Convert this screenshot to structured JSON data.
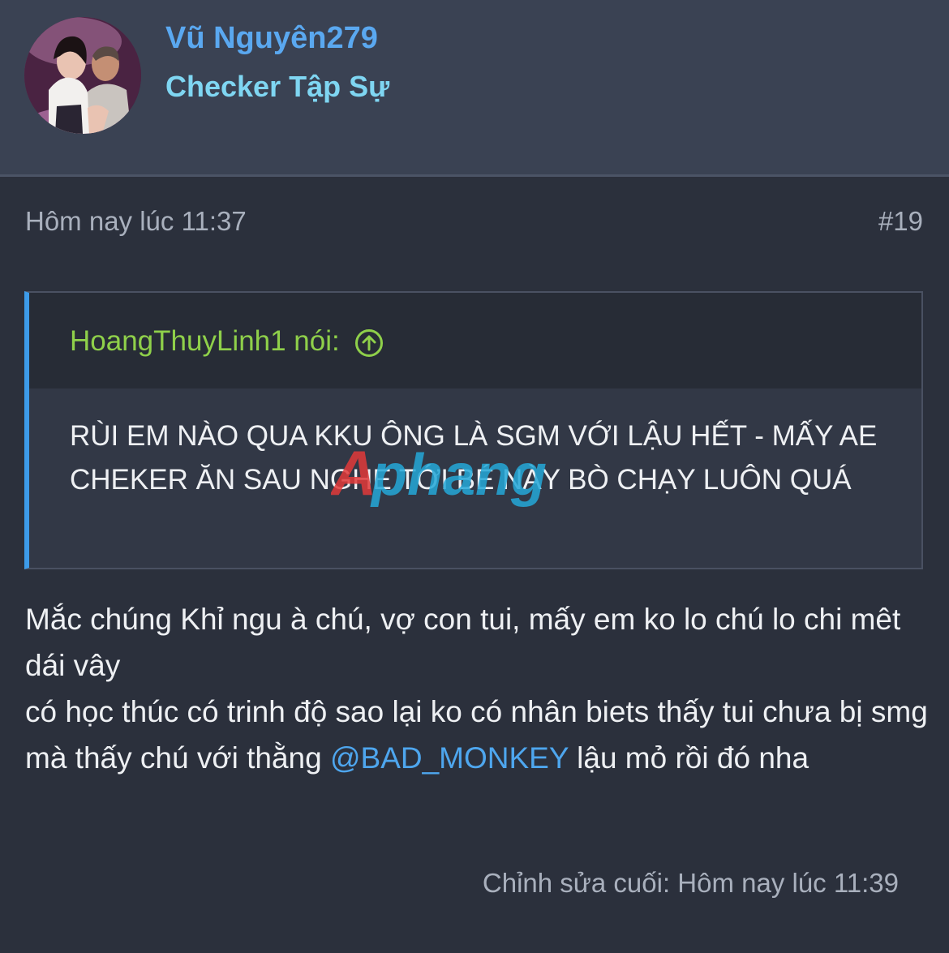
{
  "user": {
    "name": "Vũ Nguyên279",
    "title": "Checker Tập Sự"
  },
  "post": {
    "time": "Hôm nay lúc 11:37",
    "number": "#19",
    "last_edit": "Chỉnh sửa cuối: Hôm nay lúc 11:39"
  },
  "quote": {
    "author": "HoangThuyLinh1 nói:",
    "text": "RÙI EM NÀO QUA KKU ÔNG LÀ SGM VỚI LẬU HẾT - MẤY AE CHEKER ĂN SAU NGHE TỚI BÉ NÀY BÒ CHẠY LUÔN QUÁ"
  },
  "message": {
    "line1": "Mắc chúng Khỉ ngu à chú, vợ con tui, mấy em ko lo chú lo chi mêt dái vây",
    "line2_before": "có học thúc có trinh độ sao lại ko có nhân biets thấy tui chưa bị smg mà thấy chú với thằng ",
    "mention": "@BAD_MONKEY",
    "line2_after": " lậu mỏ rồi đó nha"
  },
  "watermark": {
    "text": "Aphang"
  },
  "colors": {
    "background": "#2b303c",
    "header": "#3a4253",
    "username": "#5aa8f0",
    "user_title": "#7fd6f2",
    "quote_author": "#8fd04a",
    "quote_border": "#3d9be9",
    "mention": "#4ea6ee",
    "muted": "#a9b0bd"
  },
  "icons": {
    "quote_jump": "arrow-up-circle-icon"
  }
}
